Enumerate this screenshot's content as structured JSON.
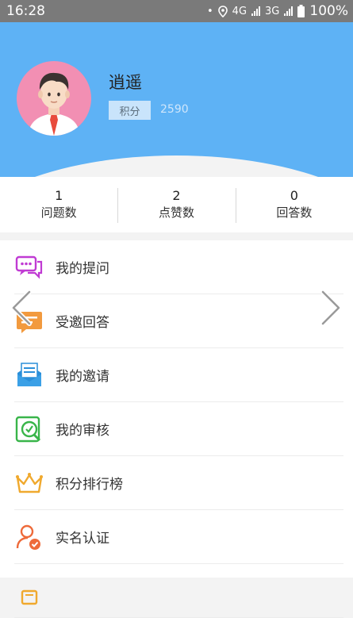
{
  "status_bar": {
    "time": "16:28",
    "network_4g": "4G",
    "network_3g": "3G",
    "battery": "100%",
    "icons": [
      "notification-dot-icon",
      "location-icon",
      "signal-icon",
      "battery-icon"
    ]
  },
  "profile": {
    "name": "逍遥",
    "points_label": "积分",
    "points_value": "2590",
    "avatar_icon": "user-avatar-icon"
  },
  "stats": [
    {
      "value": "1",
      "label": "问题数"
    },
    {
      "value": "2",
      "label": "点赞数"
    },
    {
      "value": "0",
      "label": "回答数"
    }
  ],
  "menu": [
    {
      "label": "我的提问",
      "icon": "chat-bubbles-icon"
    },
    {
      "label": "受邀回答",
      "icon": "invite-answer-icon"
    },
    {
      "label": "我的邀请",
      "icon": "envelope-icon"
    },
    {
      "label": "我的审核",
      "icon": "review-icon"
    },
    {
      "label": "积分排行榜",
      "icon": "crown-icon"
    },
    {
      "label": "实名认证",
      "icon": "verified-user-icon"
    },
    {
      "label": "",
      "icon": "gift-icon"
    }
  ],
  "colors": {
    "header_blue": "#5eb2f5",
    "page_bg": "#f3f3f3",
    "avatar_pink": "#f28fb3"
  }
}
